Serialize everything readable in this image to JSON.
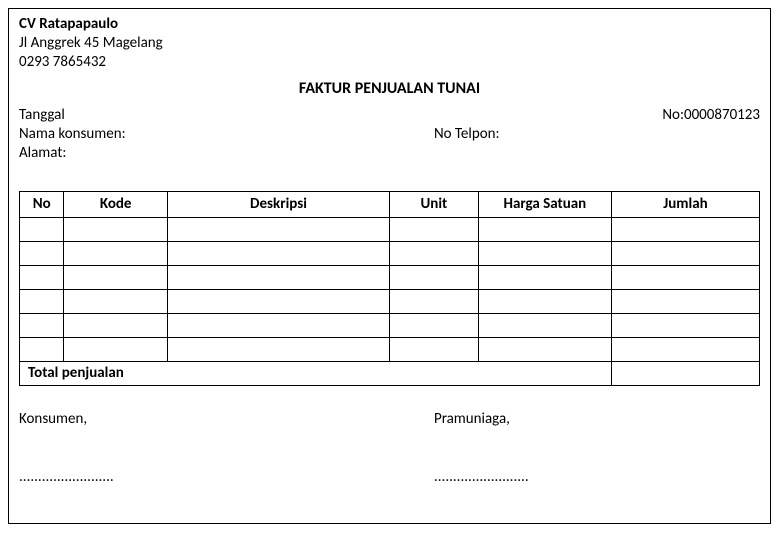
{
  "company": {
    "name": "CV Ratapapaulo",
    "address": "Jl Anggrek 45 Magelang",
    "phone": "0293 7865432"
  },
  "title": "FAKTUR PENJUALAN TUNAI",
  "fields": {
    "tanggal_label": "Tanggal",
    "tanggal_value": "",
    "no_label": "No:",
    "no_value": "0000870123",
    "nama_konsumen_label": "Nama konsumen:",
    "nama_konsumen_value": "",
    "no_telpon_label": "No Telpon:",
    "no_telpon_value": "",
    "alamat_label": "Alamat:",
    "alamat_value": ""
  },
  "table": {
    "headers": {
      "no": "No",
      "kode": "Kode",
      "deskripsi": "Deskripsi",
      "unit": "Unit",
      "harga_satuan": "Harga Satuan",
      "jumlah": "Jumlah"
    },
    "rows": [
      {
        "no": "",
        "kode": "",
        "deskripsi": "",
        "unit": "",
        "harga": "",
        "jumlah": ""
      },
      {
        "no": "",
        "kode": "",
        "deskripsi": "",
        "unit": "",
        "harga": "",
        "jumlah": ""
      },
      {
        "no": "",
        "kode": "",
        "deskripsi": "",
        "unit": "",
        "harga": "",
        "jumlah": ""
      },
      {
        "no": "",
        "kode": "",
        "deskripsi": "",
        "unit": "",
        "harga": "",
        "jumlah": ""
      },
      {
        "no": "",
        "kode": "",
        "deskripsi": "",
        "unit": "",
        "harga": "",
        "jumlah": ""
      },
      {
        "no": "",
        "kode": "",
        "deskripsi": "",
        "unit": "",
        "harga": "",
        "jumlah": ""
      }
    ],
    "total_label": "Total penjualan",
    "total_value": ""
  },
  "signatures": {
    "konsumen_label": "Konsumen,",
    "pramuniaga_label": "Pramuniaga,",
    "dots": "........................."
  }
}
